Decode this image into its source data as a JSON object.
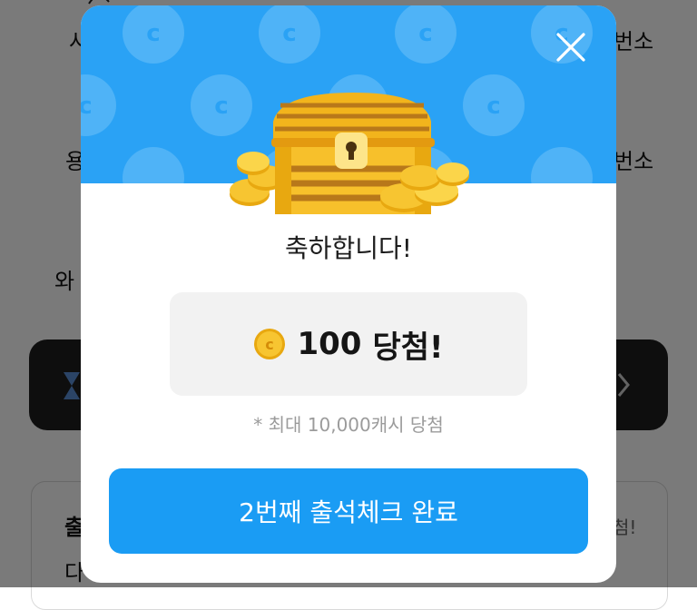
{
  "background": {
    "left_fragments": [
      "사",
      "용",
      "와"
    ],
    "right_fragments": [
      "번소",
      "번소"
    ],
    "card_heading_fragment": "출",
    "card_line_fragment": "다",
    "card_right_fragment": "첨!"
  },
  "modal": {
    "header_color": "#2aa2f5",
    "close_icon": "close-icon",
    "illustration": "treasure-chest-with-coins",
    "congrats_text": "축하합니다!",
    "prize": {
      "amount": "100",
      "suffix": "당첨!",
      "icon": "coin-icon"
    },
    "note": "* 최대 10,000캐시 당첨",
    "confirm_label": "2번째 출석체크 완료",
    "accent_color": "#1a9cf4"
  }
}
